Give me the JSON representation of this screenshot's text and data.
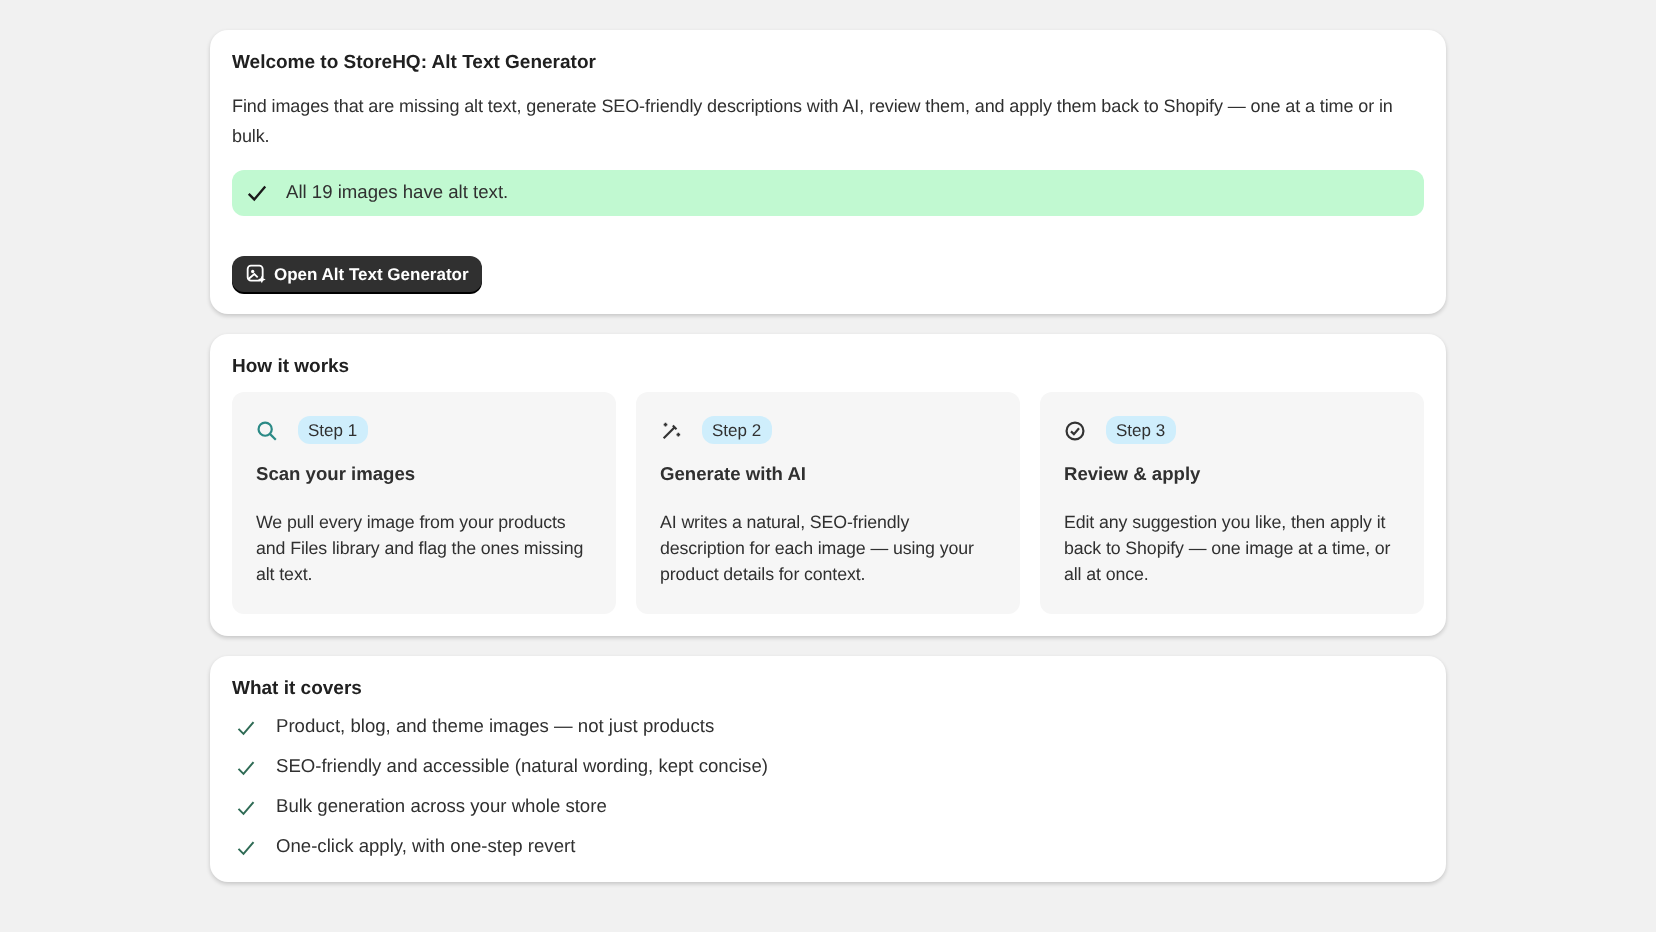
{
  "welcome": {
    "title": "Welcome to StoreHQ: Alt Text Generator",
    "description": "Find images that are missing alt text, generate SEO-friendly descriptions with AI, review them, and apply them back to Shopify — one at a time or in bulk.",
    "banner": {
      "kind": "success",
      "text": "All 19 images have alt text."
    },
    "button": "Open Alt Text Generator"
  },
  "how_it_works": {
    "title": "How it works",
    "steps": [
      {
        "kind": "search",
        "badge": "Step 1",
        "title": "Scan your images",
        "text": "We pull every image from your products and Files library and flag the ones missing alt text."
      },
      {
        "kind": "wand",
        "badge": "Step 2",
        "title": "Generate with AI",
        "text": "AI writes a natural, SEO-friendly description for each image — using your product details for context."
      },
      {
        "kind": "check",
        "badge": "Step 3",
        "title": "Review & apply",
        "text": "Edit any suggestion you like, then apply it back to Shopify — one image at a time, or all at once."
      }
    ]
  },
  "covers": {
    "title": "What it covers",
    "items": [
      "Product, blog, and theme images — not just products",
      "SEO-friendly and accessible (natural wording, kept concise)",
      "Bulk generation across your whole store",
      "One-click apply, with one-step revert"
    ]
  }
}
